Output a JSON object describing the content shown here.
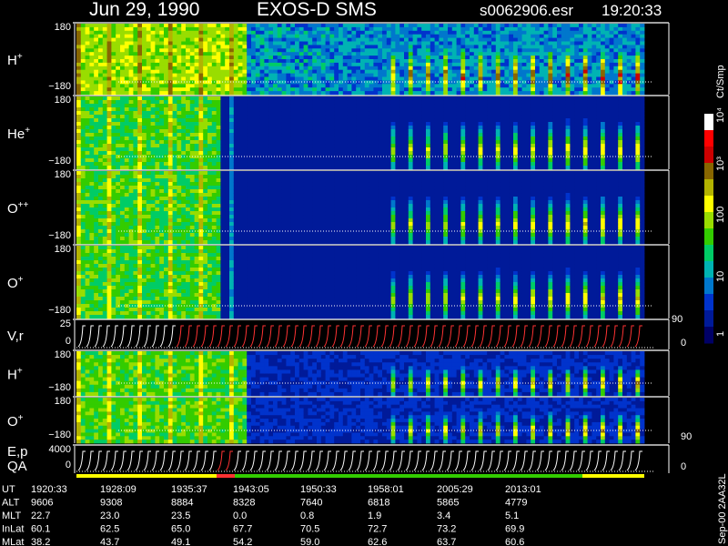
{
  "header": {
    "date": "Jun 29, 1990",
    "mission": "EXOS-D SMS",
    "file": "s0062906.esr",
    "time": "19:20:33"
  },
  "colorbar": {
    "unit_label": "Ct/Smp",
    "ticks": [
      "1",
      "10",
      "100",
      "10³",
      "10⁴"
    ],
    "colors": [
      "#000066",
      "#001a99",
      "#0033cc",
      "#0077cc",
      "#00b3b3",
      "#00cc66",
      "#33cc00",
      "#99dd00",
      "#ffff00",
      "#b3b300",
      "#886600",
      "#cc0000",
      "#ff0000",
      "#ffffff"
    ]
  },
  "chart_data": {
    "type": "heatmap",
    "title": "Jun 29, 1990   EXOS-D SMS",
    "panels": [
      {
        "label": "H",
        "superscript": "+",
        "ymax": "180",
        "ymin": "−180"
      },
      {
        "label": "He",
        "superscript": "+",
        "ymax": "180",
        "ymin": "−180"
      },
      {
        "label": "O",
        "superscript": "++",
        "ymax": "180",
        "ymin": "−180"
      },
      {
        "label": "O",
        "superscript": "+",
        "ymax": "180",
        "ymin": "−180"
      },
      {
        "label": "V,r",
        "superscript": "",
        "ymax": "25",
        "ymin": "0",
        "right_top": "90",
        "right_bottom": "0"
      },
      {
        "label": "H",
        "superscript": "+",
        "ymax": "180",
        "ymin": "−180"
      },
      {
        "label": "O",
        "superscript": "+",
        "ymax": "180",
        "ymin": "−180",
        "right_bottom": "90"
      },
      {
        "label": "E,p",
        "label2": "QA",
        "superscript": "",
        "ymax": "4000",
        "ymin": "0",
        "right_bottom": "0"
      }
    ],
    "x_ticks": [
      "1920:33",
      "1928:09",
      "1935:37",
      "1943:05",
      "1950:33",
      "1958:01",
      "2005:29",
      "2013:01"
    ],
    "table": [
      {
        "label": "UT",
        "values": [
          "1920:33",
          "1928:09",
          "1935:37",
          "1943:05",
          "1950:33",
          "1958:01",
          "2005:29",
          "2013:01"
        ]
      },
      {
        "label": "ALT",
        "values": [
          "9606",
          "9308",
          "8884",
          "8328",
          "7640",
          "6818",
          "5865",
          "4779"
        ]
      },
      {
        "label": "MLT",
        "values": [
          "22.7",
          "23.0",
          "23.5",
          "0.0",
          "0.8",
          "1.9",
          "3.4",
          "5.1"
        ]
      },
      {
        "label": "InLat",
        "values": [
          "60.1",
          "62.5",
          "65.0",
          "67.7",
          "70.5",
          "72.7",
          "73.2",
          "69.9"
        ]
      },
      {
        "label": "MLat",
        "values": [
          "38.2",
          "43.7",
          "49.1",
          "54.2",
          "59.0",
          "62.6",
          "63.7",
          "60.6"
        ]
      }
    ],
    "side_label": "Sep-00 2AA32L"
  }
}
